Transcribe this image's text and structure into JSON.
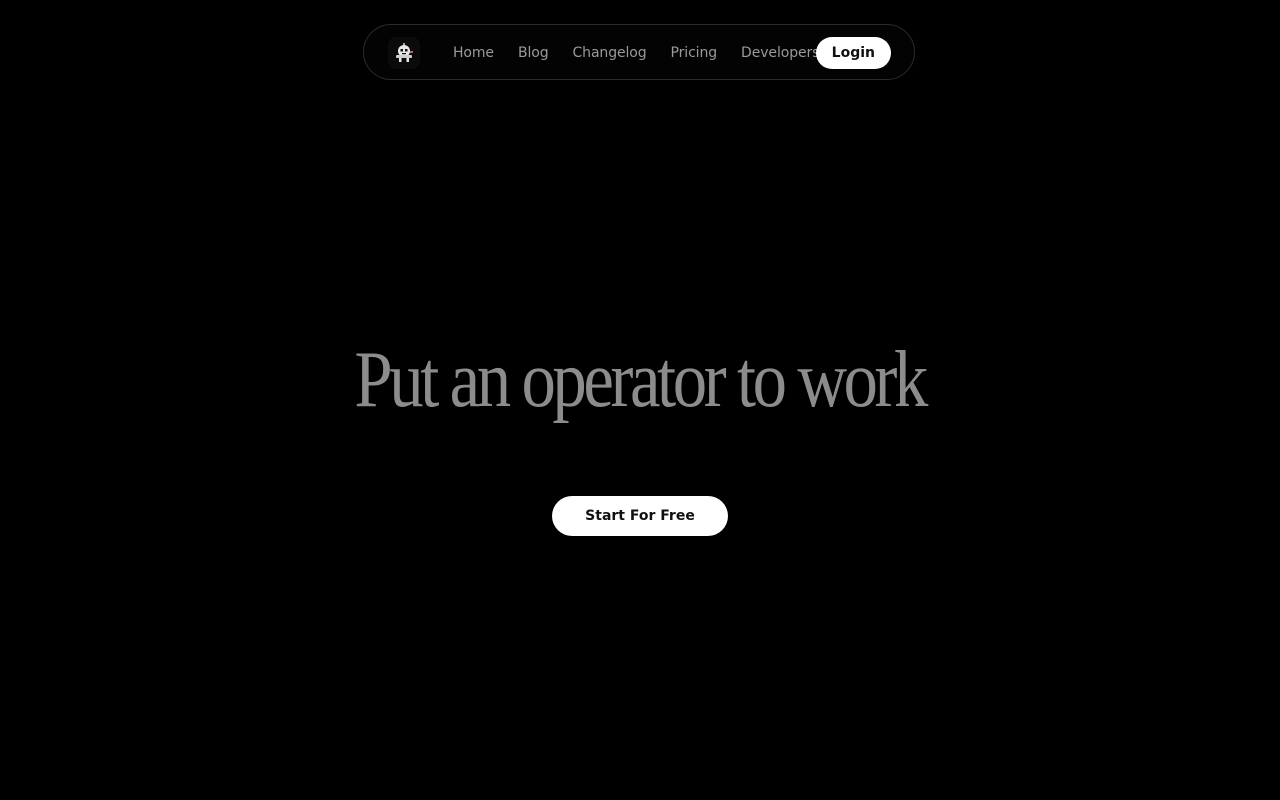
{
  "nav": {
    "logo_icon": "robot-mascot-icon",
    "links": [
      {
        "label": "Home"
      },
      {
        "label": "Blog"
      },
      {
        "label": "Changelog"
      },
      {
        "label": "Pricing"
      },
      {
        "label": "Developers"
      }
    ],
    "login_label": "Login"
  },
  "hero": {
    "title": "Put an operator to work",
    "cta_label": "Start For Free"
  },
  "colors": {
    "background": "#000000",
    "nav_text": "#9a9a9a",
    "title_text": "#8c8c8c",
    "button_bg": "#ffffff",
    "button_text": "#111111"
  }
}
